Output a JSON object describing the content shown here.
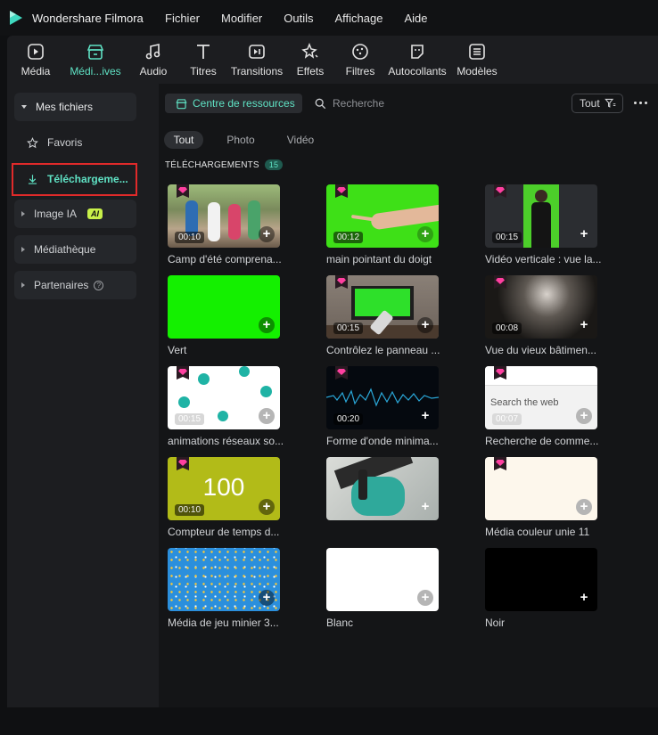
{
  "app": {
    "title": "Wondershare Filmora"
  },
  "menu": [
    "Fichier",
    "Modifier",
    "Outils",
    "Affichage",
    "Aide"
  ],
  "toolbar": [
    {
      "label": "Média",
      "icon": "media-icon"
    },
    {
      "label": "Médi...ives",
      "icon": "store-icon",
      "active": true
    },
    {
      "label": "Audio",
      "icon": "music-icon"
    },
    {
      "label": "Titres",
      "icon": "title-icon"
    },
    {
      "label": "Transitions",
      "icon": "transition-icon"
    },
    {
      "label": "Effets",
      "icon": "effects-icon"
    },
    {
      "label": "Filtres",
      "icon": "filter-icon"
    },
    {
      "label": "Autocollants",
      "icon": "sticker-icon"
    },
    {
      "label": "Modèles",
      "icon": "template-icon"
    }
  ],
  "sidebar": {
    "mes_fichiers": "Mes fichiers",
    "favoris": "Favoris",
    "telechargements": "Téléchargeme...",
    "image_ia": "Image IA",
    "ai_badge": "AI",
    "mediatheque": "Médiathèque",
    "partenaires": "Partenaires"
  },
  "main": {
    "resource_center": "Centre de ressources",
    "search_placeholder": "Recherche",
    "filter_label": "Tout",
    "tabs": [
      "Tout",
      "Photo",
      "Vidéo"
    ],
    "section": "TÉLÉCHARGEMENTS",
    "count": "15"
  },
  "colors": {
    "accent": "#5fe2c4",
    "highlight": "#e02a2a",
    "premium": "#ff3fa0"
  },
  "items": [
    {
      "caption": "Camp d'été comprena...",
      "duration": "00:10",
      "premium": true
    },
    {
      "caption": "main pointant du doigt",
      "duration": "00:12",
      "premium": true
    },
    {
      "caption": "Vidéo verticale : vue la...",
      "duration": "00:15",
      "premium": true
    },
    {
      "caption": "Vert",
      "duration": "",
      "premium": false
    },
    {
      "caption": "Contrôlez le panneau ...",
      "duration": "00:15",
      "premium": true
    },
    {
      "caption": "Vue du vieux bâtimen...",
      "duration": "00:08",
      "premium": true
    },
    {
      "caption": "animations réseaux so...",
      "duration": "00:15",
      "premium": true
    },
    {
      "caption": "Forme d'onde minima...",
      "duration": "00:20",
      "premium": true
    },
    {
      "caption": "Recherche de comme...",
      "duration": "00:07",
      "premium": true,
      "overlay_text": "Search the web"
    },
    {
      "caption": "Compteur de temps d...",
      "duration": "00:10",
      "premium": true,
      "overlay_text": "100"
    },
    {
      "caption": "",
      "duration": "",
      "premium": false
    },
    {
      "caption": "Média couleur unie 11",
      "duration": "",
      "premium": true
    },
    {
      "caption": "Média de jeu minier 3...",
      "duration": "",
      "premium": false
    },
    {
      "caption": "Blanc",
      "duration": "",
      "premium": false
    },
    {
      "caption": "Noir",
      "duration": "",
      "premium": false
    }
  ]
}
